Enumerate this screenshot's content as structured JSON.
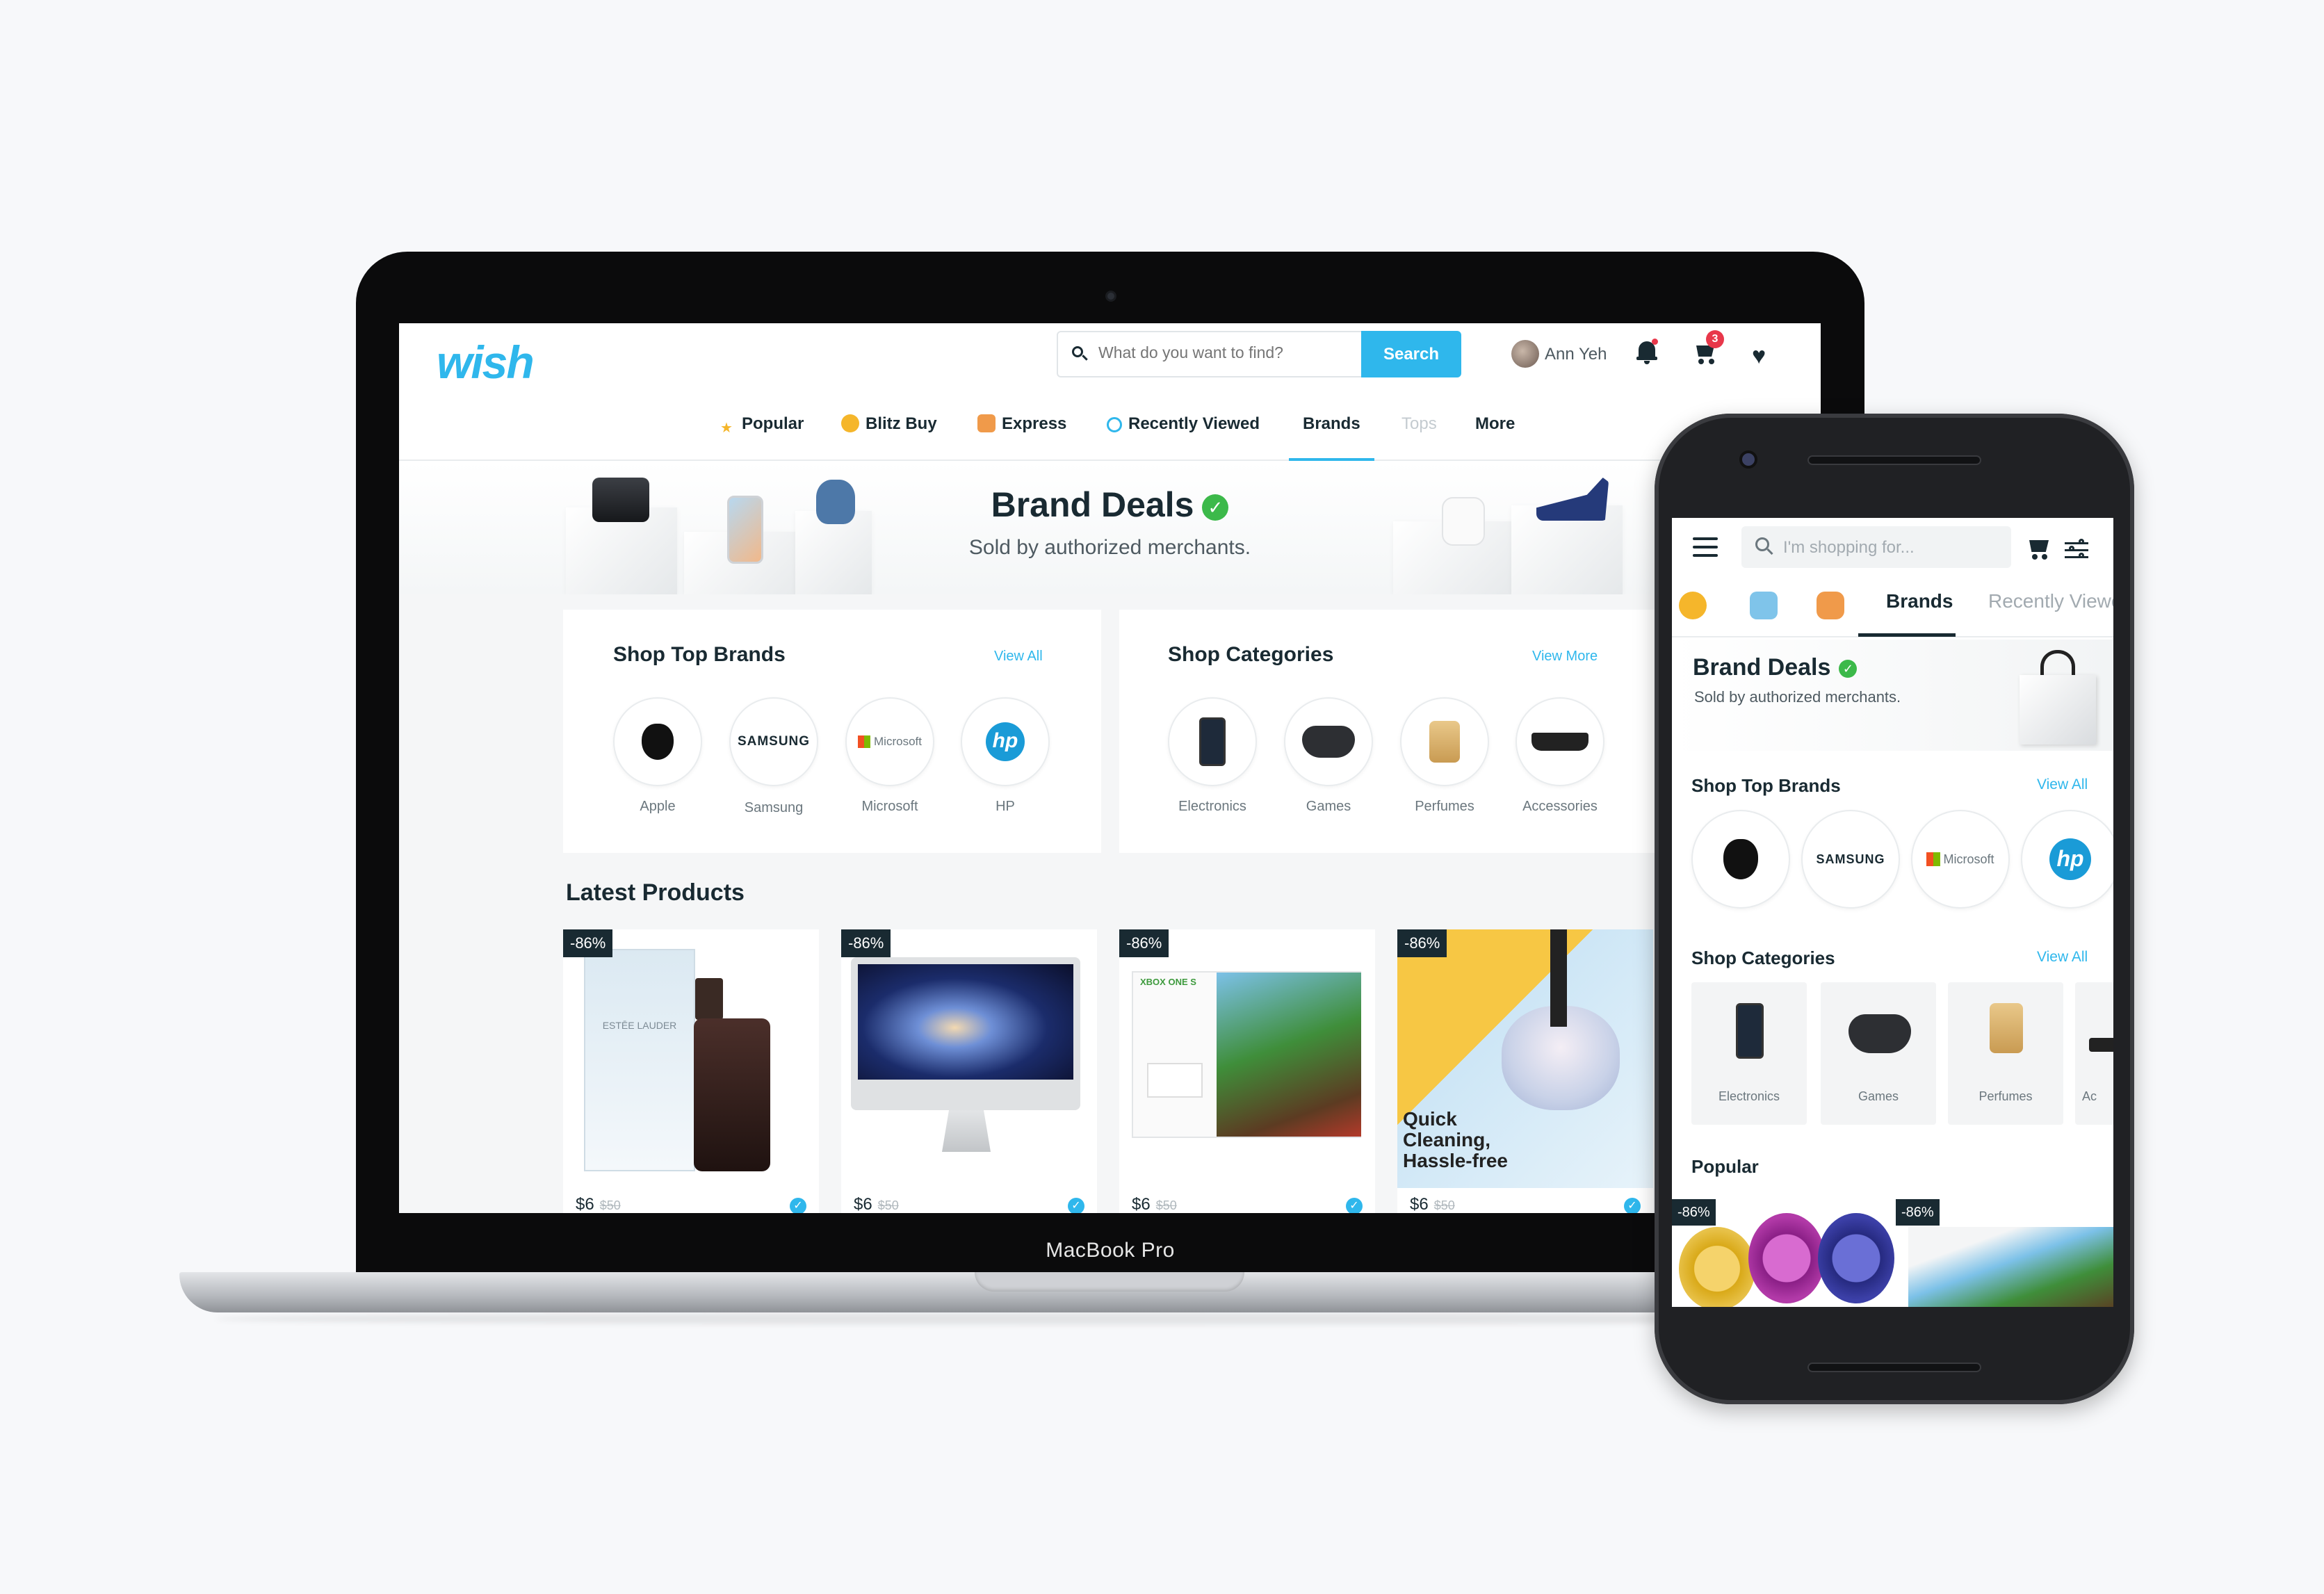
{
  "laptop": {
    "model_label": "MacBook Pro",
    "header": {
      "logo": "wish",
      "search_placeholder": "What do you want to find?",
      "search_button": "Search",
      "user_name": "Ann Yeh",
      "cart_count": "3"
    },
    "nav": [
      {
        "label": "Popular",
        "icon": "star-icon",
        "state": "normal"
      },
      {
        "label": "Blitz Buy",
        "icon": "coin-icon",
        "state": "normal"
      },
      {
        "label": "Express",
        "icon": "truck-icon",
        "state": "normal"
      },
      {
        "label": "Recently Viewed",
        "icon": "clock-icon",
        "state": "normal"
      },
      {
        "label": "Brands",
        "icon": "",
        "state": "active"
      },
      {
        "label": "Tops",
        "icon": "",
        "state": "muted"
      },
      {
        "label": "More",
        "icon": "",
        "state": "normal"
      }
    ],
    "hero": {
      "title": "Brand Deals",
      "subtitle": "Sold by authorized merchants."
    },
    "top_brands": {
      "title": "Shop Top Brands",
      "link": "View All",
      "items": [
        {
          "label": "Apple",
          "logo": ""
        },
        {
          "label": "Samsung",
          "logo": "SAMSUNG"
        },
        {
          "label": "Microsoft",
          "logo": "Microsoft"
        },
        {
          "label": "HP",
          "logo": "hp"
        }
      ]
    },
    "categories": {
      "title": "Shop Categories",
      "link": "View More",
      "items": [
        {
          "label": "Electronics"
        },
        {
          "label": "Games"
        },
        {
          "label": "Perfumes"
        },
        {
          "label": "Accessories"
        }
      ]
    },
    "latest": {
      "title": "Latest Products",
      "products": [
        {
          "discount": "-86%",
          "price": "$6",
          "was": "$50"
        },
        {
          "discount": "-86%",
          "price": "$6",
          "was": "$50"
        },
        {
          "discount": "-86%",
          "price": "$6",
          "was": "$50"
        },
        {
          "discount": "-86%",
          "price": "$6",
          "was": "$50",
          "overlay_text": "Quick Cleaning, Hassle-free"
        }
      ],
      "product_text": {
        "estee_brand": "ESTĒE LAUDER",
        "xbox_brand": "XBOX ONE S"
      }
    }
  },
  "phone": {
    "search_placeholder": "I'm shopping for...",
    "tabs": [
      "Brands",
      "Recently Viewed"
    ],
    "hero": {
      "title": "Brand Deals",
      "subtitle": "Sold by authorized merchants."
    },
    "top_brands": {
      "title": "Shop Top Brands",
      "link": "View All",
      "logos": [
        "",
        "SAMSUNG",
        "Microsoft",
        "hp"
      ]
    },
    "categories": {
      "title": "Shop Categories",
      "link": "View All",
      "items": [
        {
          "label": "Electronics"
        },
        {
          "label": "Games"
        },
        {
          "label": "Perfumes"
        },
        {
          "label": "Ac"
        }
      ]
    },
    "popular": {
      "title": "Popular",
      "badges": [
        "-86%",
        "-86%"
      ]
    }
  },
  "colors": {
    "brand": "#2fb7ec",
    "text": "#192a32",
    "badge_red": "#e8374a",
    "verified_green": "#3cb94a"
  }
}
